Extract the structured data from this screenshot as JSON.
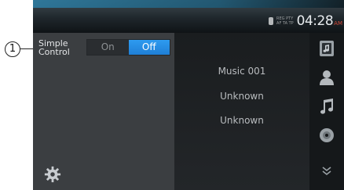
{
  "callout": {
    "number": "1"
  },
  "status": {
    "flag_top": "REG  PTY",
    "flag_bottom": "AF  TA  TP",
    "time": "04:28",
    "ampm": "AM"
  },
  "settings": {
    "simple_control_label_line1": "Simple",
    "simple_control_label_line2": "Control",
    "on_label": "On",
    "off_label": "Off",
    "selected": "Off"
  },
  "now_playing": {
    "title": "Music 001",
    "artist": "Unknown",
    "album": "Unknown"
  },
  "side_buttons": [
    "music-folder-icon",
    "artist-icon",
    "music-note-icon",
    "disc-icon",
    "more-chevron-icon"
  ],
  "colors": {
    "accent_blue": "#2e9bf0",
    "clock_ampm": "#d24a3a"
  }
}
